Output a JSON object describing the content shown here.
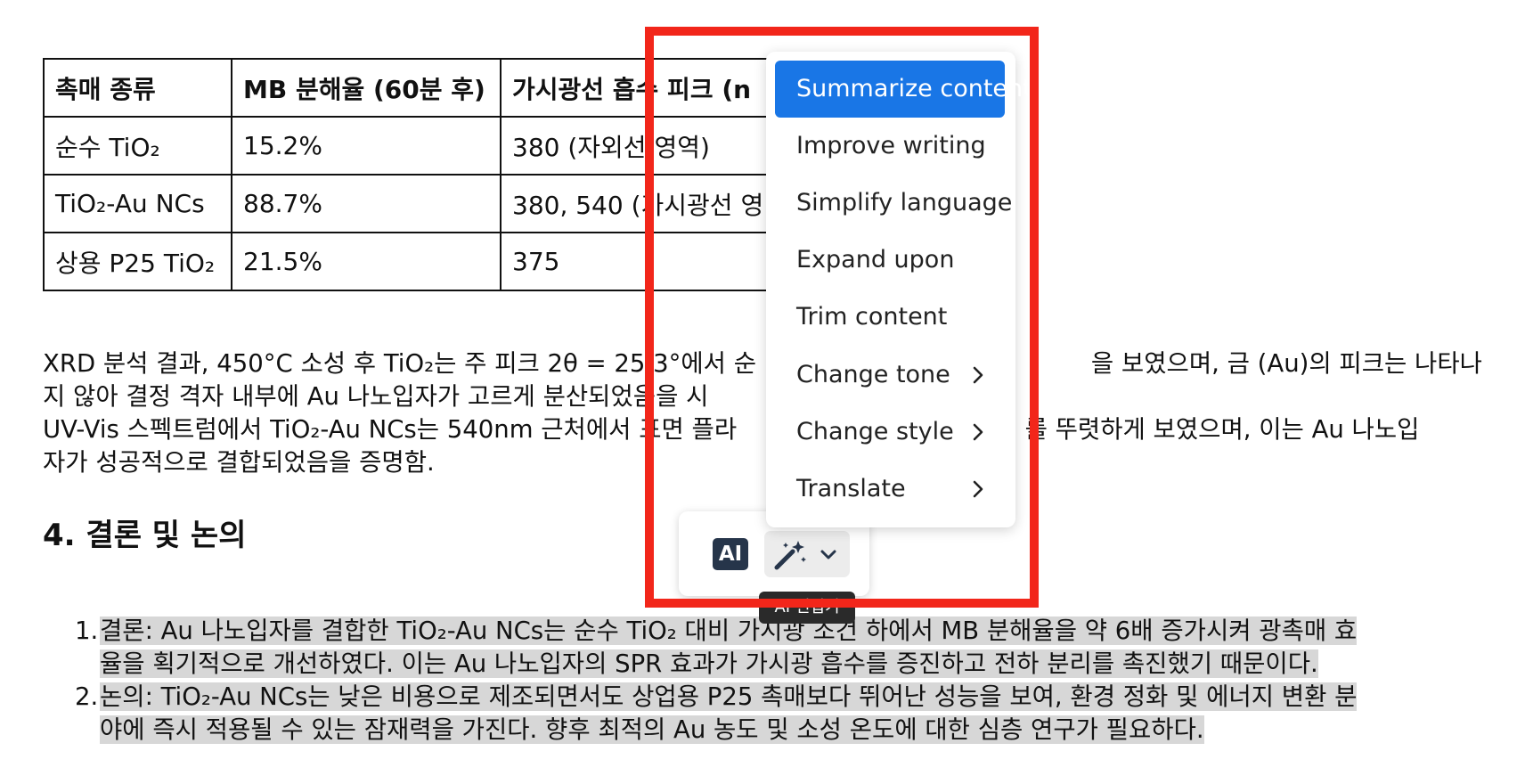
{
  "table": {
    "headers": [
      "촉매 종류",
      "MB 분해율 (60분 후)",
      "가시광선 흡수 피크 (n"
    ],
    "rows": [
      [
        "순수 TiO₂",
        "15.2%",
        "380 (자외선 영역)"
      ],
      [
        "TiO₂-Au NCs",
        "88.7%",
        "380, 540 (가시광선 영"
      ],
      [
        "상용 P25 TiO₂",
        "21.5%",
        "375"
      ]
    ]
  },
  "paragraph1": {
    "line1": "XRD 분석 결과, 450°C 소성 후 TiO₂는 주 피크 2θ = 25.3°에서 순                                           을 보였으며, 금 (Au)의 피크는 나타나",
    "line2": "지 않아 결정 격자 내부에 Au 나노입자가 고르게 분산되었음을 시"
  },
  "paragraph2": {
    "line1": "UV-Vis 스펙트럼에서 TiO₂-Au NCs는 540nm 근처에서 표면 플라                                     를 뚜렷하게 보였으며, 이는 Au 나노입",
    "line2": "자가 성공적으로 결합되었음을 증명함."
  },
  "heading": "4. 결론 및 논의",
  "list": [
    {
      "num": "1.",
      "line1": "결론: Au 나노입자를 결합한 TiO₂-Au NCs는 순수 TiO₂ 대비 가시광 조건 하에서 MB 분해율을 약 6배 증가시켜 광촉매 효",
      "line2": "율을 획기적으로 개선하였다. 이는 Au 나노입자의 SPR 효과가 가시광 흡수를 증진하고 전하 분리를 촉진했기 때문이다."
    },
    {
      "num": "2.",
      "line1": "논의: TiO₂-Au NCs는 낮은 비용으로 제조되면서도 상업용 P25 촉매보다 뛰어난 성능을 보여, 환경 정화 및 에너지 변환 분",
      "line2": "야에 즉시 적용될 수 있는 잠재력을 가진다. 향후 최적의 Au 농도 및 소성 온도에 대한 심층 연구가 필요하다."
    }
  ],
  "ai_toolbar": {
    "badge": "AI",
    "tooltip": "AI 편집기",
    "wand_icon": "magic-wand-icon",
    "chevron_icon": "chevron-down-icon"
  },
  "menu": {
    "items": [
      {
        "label": "Summarize content",
        "active": true
      },
      {
        "label": "Improve writing"
      },
      {
        "label": "Simplify language"
      },
      {
        "label": "Expand upon"
      },
      {
        "label": "Trim content"
      },
      {
        "label": "Change tone",
        "submenu": true
      },
      {
        "label": "Change style",
        "submenu": true
      },
      {
        "label": "Translate",
        "submenu": true
      }
    ]
  },
  "colors": {
    "accent": "#1976e6",
    "highlight_frame": "#f2261a",
    "selection": "#d7d7d7"
  }
}
